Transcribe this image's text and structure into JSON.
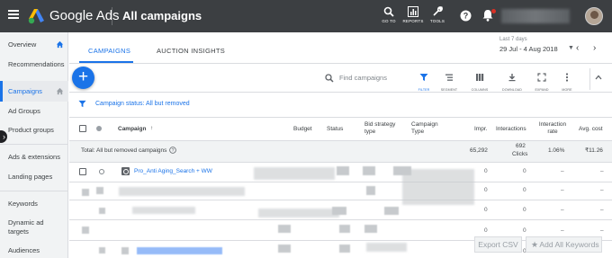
{
  "topbar": {
    "brand": "Google Ads",
    "title": "All campaigns",
    "buttons": [
      {
        "label": "GO TO",
        "icon": "search-icon"
      },
      {
        "label": "REPORTS",
        "icon": "bar-chart-icon"
      },
      {
        "label": "TOOLS",
        "icon": "wrench-icon"
      }
    ],
    "colors": {
      "bar": "#3c3f42",
      "accent": "#1a73e8"
    }
  },
  "sidebar": {
    "items": [
      {
        "label": "Overview"
      },
      {
        "label": "Recommendations"
      },
      {
        "label": "Campaigns",
        "selected": true
      },
      {
        "label": "Ad Groups"
      },
      {
        "label": "Product groups"
      },
      {
        "label": "Ads & extensions"
      },
      {
        "label": "Landing pages"
      },
      {
        "label": "Keywords"
      },
      {
        "label": "Dynamic ad targets"
      },
      {
        "label": "Audiences"
      }
    ]
  },
  "tabs": [
    "CAMPAIGNS",
    "AUCTION INSIGHTS"
  ],
  "date": {
    "label": "Last 7 days",
    "range": "29 Jul - 4 Aug 2018"
  },
  "toolbar": {
    "search_placeholder": "Find campaigns",
    "tools": [
      "FILTER",
      "SEGMENT",
      "COLUMNS",
      "DOWNLOAD",
      "EXPAND",
      "MORE"
    ]
  },
  "filter": {
    "text": "Campaign status: All but removed"
  },
  "table": {
    "columns": {
      "campaign": "Campaign",
      "budget": "Budget",
      "status": "Status",
      "bid_strategy": "Bid strategy type",
      "campaign_type": "Campaign Type",
      "impr": "Impr.",
      "interactions": "Interactions",
      "interaction_rate": "Interaction rate",
      "avg_cost": "Avg. cost"
    },
    "total": {
      "label": "Total: All but removed campaigns",
      "impr": "65,292",
      "interactions": "692",
      "interactions_unit": "Clicks",
      "interaction_rate": "1.06%",
      "avg_cost": "₹11.26"
    },
    "rows": [
      {
        "campaign": "Pro_Anti Aging_Search + WW",
        "impr": "0",
        "interactions": "0",
        "interaction_rate": "–",
        "avg_cost": "–"
      },
      {
        "campaign": "",
        "impr": "0",
        "interactions": "0",
        "interaction_rate": "–",
        "avg_cost": "–"
      },
      {
        "campaign": "",
        "impr": "0",
        "interactions": "0",
        "interaction_rate": "–",
        "avg_cost": "–"
      },
      {
        "campaign": "",
        "impr": "0",
        "interactions": "0",
        "interaction_rate": "–",
        "avg_cost": "–"
      },
      {
        "campaign": "",
        "impr": "0",
        "interactions": "0",
        "interaction_rate": "–",
        "avg_cost": "–"
      }
    ]
  },
  "footer": {
    "export": "Export CSV",
    "add_keywords": "Add All Keywords"
  }
}
